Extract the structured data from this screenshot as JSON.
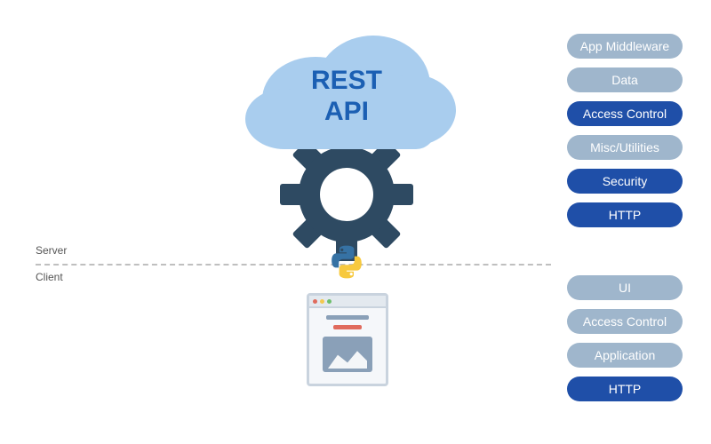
{
  "cloud": {
    "line1": "REST",
    "line2": "API"
  },
  "labels": {
    "server": "Server",
    "client": "Client"
  },
  "server_pills": [
    {
      "text": "App Middleware",
      "tone": "light"
    },
    {
      "text": "Data",
      "tone": "light"
    },
    {
      "text": "Access Control",
      "tone": "dark"
    },
    {
      "text": "Misc/Utilities",
      "tone": "light"
    },
    {
      "text": "Security",
      "tone": "dark"
    },
    {
      "text": "HTTP",
      "tone": "dark"
    }
  ],
  "client_pills": [
    {
      "text": "UI",
      "tone": "light"
    },
    {
      "text": "Access Control",
      "tone": "light"
    },
    {
      "text": "Application",
      "tone": "light"
    },
    {
      "text": "HTTP",
      "tone": "dark"
    }
  ],
  "colors": {
    "cloud_fill": "#a9cdee",
    "cloud_text": "#1b5fb3",
    "gear": "#2e4a62",
    "pill_light": "#9fb6cc",
    "pill_dark": "#1f4fa8"
  }
}
